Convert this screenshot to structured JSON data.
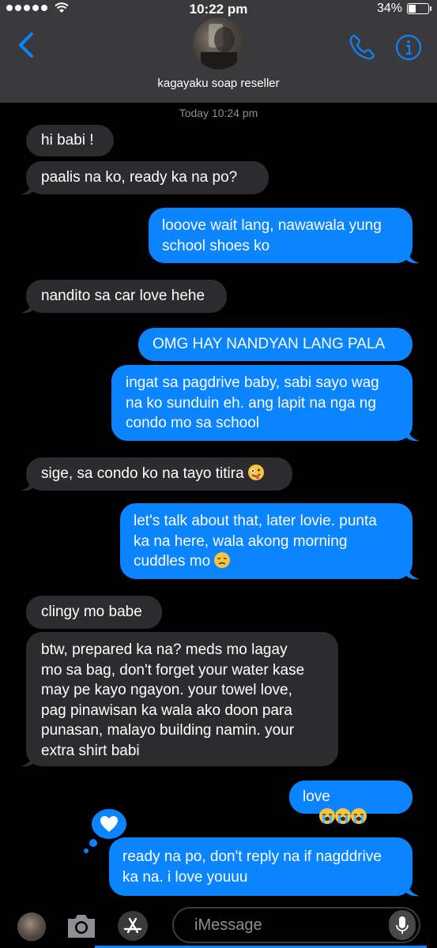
{
  "status_bar": {
    "time": "10:22 pm",
    "battery": "34%",
    "battery_level": 0.34
  },
  "header": {
    "contact_name": "kagayaku soap reseller"
  },
  "conversation": {
    "timestamp": "Today 10:24 pm",
    "messages": [
      {
        "from": "them",
        "text": "hi babi !"
      },
      {
        "from": "them",
        "text": "paalis na ko, ready ka na po?"
      },
      {
        "from": "me",
        "text": "looove wait lang, nawawala yung\nschool shoes ko"
      },
      {
        "from": "them",
        "text": "nandito sa car love hehe"
      },
      {
        "from": "me",
        "text": "OMG HAY NANDYAN LANG PALA"
      },
      {
        "from": "me",
        "text": "ingat sa pagdrive baby, sabi sayo wag\nna ko sunduin eh. ang lapit na nga ng\ncondo mo sa school"
      },
      {
        "from": "them",
        "text": "sige, sa condo ko na tayo titira",
        "emoji": "zany-face"
      },
      {
        "from": "me",
        "text": "let's talk about that, later lovie. punta\nka na here, wala akong morning\ncuddles mo",
        "emoji": "disappointed-face"
      },
      {
        "from": "them",
        "text": "clingy mo babe"
      },
      {
        "from": "them",
        "text": "btw, prepared ka na? meds mo lagay\nmo sa bag, don't forget your water kase\nmay pe kayo ngayon. your towel love,\npag pinawisan ka wala ako doon para\npunasan, malayo building namin. your\nextra shirt babi"
      },
      {
        "from": "me",
        "text": "love",
        "emoji": "loudly-crying-face x3"
      },
      {
        "from": "me",
        "text": "ready na po, don't reply na if nagddrive\nka na. i love youuu",
        "tapback": "heart"
      }
    ]
  },
  "composer": {
    "placeholder": "iMessage"
  },
  "colors": {
    "bubble_me": "#0b84ff",
    "bubble_them": "#2c2c2e",
    "header_bg": "#3a3a3c",
    "accent": "#0b84ff"
  }
}
